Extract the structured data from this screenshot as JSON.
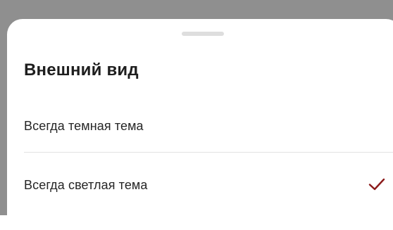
{
  "sheet": {
    "title": "Внешний вид",
    "options": [
      {
        "label": "Всегда темная тема",
        "selected": false
      },
      {
        "label": "Всегда светлая тема",
        "selected": true
      }
    ]
  },
  "colors": {
    "backdrop": "#8f8f8f",
    "sheet": "#ffffff",
    "accent_check": "#8b1a1a",
    "text": "#262626",
    "divider": "#e3e3e3",
    "handle": "#dedede"
  },
  "icons": {
    "selected": "check-icon"
  }
}
